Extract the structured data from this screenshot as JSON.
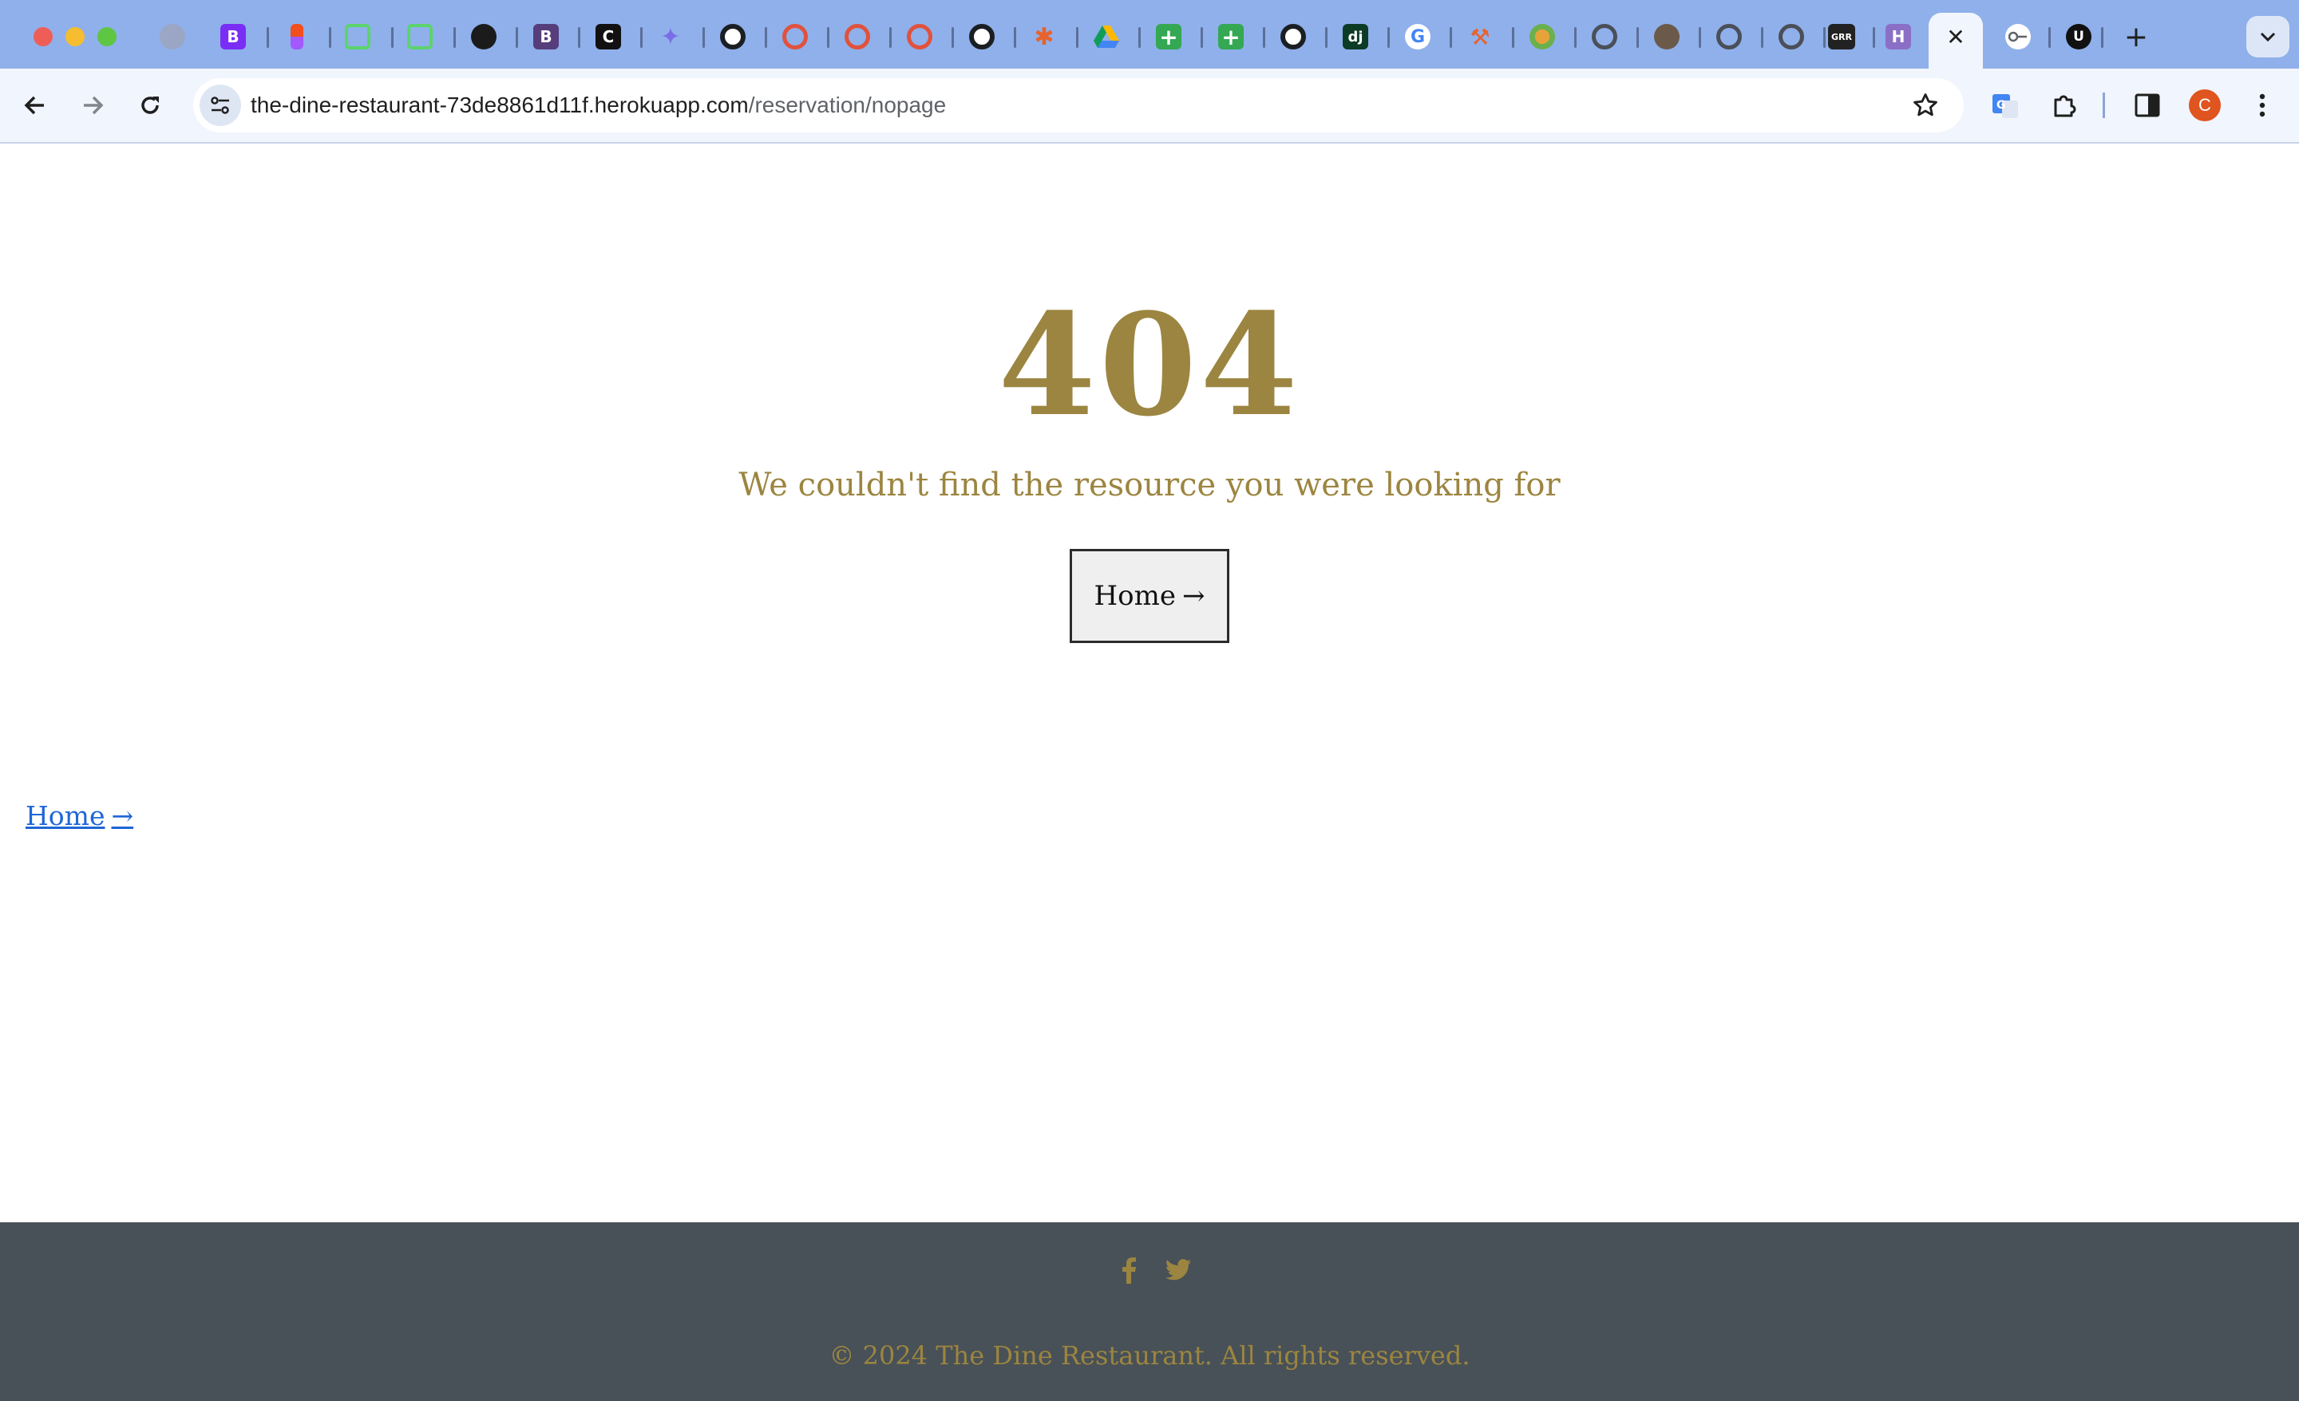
{
  "browser": {
    "tab_close_glyph": "✕",
    "new_tab_glyph": "+",
    "url_host": "the-dine-restaurant-73de8861d11f.herokuapp.com",
    "url_path": "/reservation/nopage",
    "profile_initial": "C",
    "profile_color": "#e0541f",
    "tabstrip_color": "#8fb0ea",
    "toolbar_color": "#f1f5fd"
  },
  "page": {
    "error_code": "404",
    "message": "We couldn't find the resource you were looking for",
    "home_button_label": "Home",
    "home_link_label": "Home",
    "arrow_glyph": "→",
    "accent_color": "#9c8540",
    "link_color": "#1e66d6"
  },
  "footer": {
    "copyright": "© 2024 The Dine Restaurant. All rights reserved.",
    "background_color": "#485157",
    "social_icons": [
      "facebook-icon",
      "twitter-icon"
    ]
  }
}
